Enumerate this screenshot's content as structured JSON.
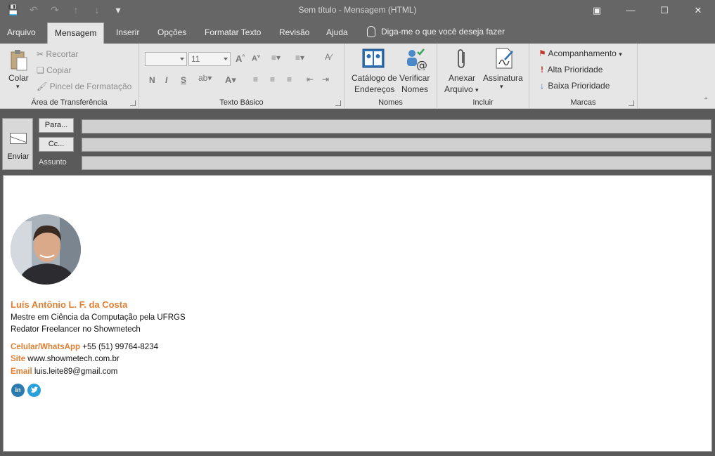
{
  "window": {
    "title": "Sem título  -  Mensagem (HTML)"
  },
  "tabs": [
    {
      "label": "Arquivo"
    },
    {
      "label": "Mensagem"
    },
    {
      "label": "Inserir"
    },
    {
      "label": "Opções"
    },
    {
      "label": "Formatar Texto"
    },
    {
      "label": "Revisão"
    },
    {
      "label": "Ajuda"
    }
  ],
  "tell_me": "Diga-me o que você deseja fazer",
  "ribbon": {
    "clipboard": {
      "label": "Área de Transferência",
      "paste": "Colar",
      "cut": "Recortar",
      "copy": "Copiar",
      "format_painter": "Pincel de Formatação"
    },
    "basic_text": {
      "label": "Texto Básico",
      "font_size": "11",
      "bold": "N",
      "italic": "I",
      "underline": "S",
      "font_color": "A"
    },
    "names": {
      "label": "Nomes",
      "address_book_1": "Catálogo de",
      "address_book_2": "Endereços",
      "check_names_1": "Verificar",
      "check_names_2": "Nomes"
    },
    "include": {
      "label": "Incluir",
      "attach_1": "Anexar",
      "attach_2": "Arquivo",
      "signature": "Assinatura"
    },
    "tags": {
      "label": "Marcas",
      "follow_up": "Acompanhamento",
      "high_priority": "Alta Prioridade",
      "low_priority": "Baixa Prioridade"
    }
  },
  "compose": {
    "send": "Enviar",
    "to_button": "Para...",
    "cc_button": "Cc...",
    "subject_label": "Assunto",
    "to_value": "",
    "cc_value": "",
    "subject_value": ""
  },
  "signature": {
    "name": "Luís Antônio L. F. da Costa",
    "line1": "Mestre em Ciência da Computação pela UFRGS",
    "line2": "Redator Freelancer no Showmetech",
    "phone_label": "Celular/WhatsApp",
    "phone_value": "+55 (51) 99764-8234",
    "site_label": "Site",
    "site_value": "www.showmetech.com.br",
    "email_label": "Email",
    "email_value": "luis.leite89@gmail.com",
    "linkedin_text": "in",
    "colors": {
      "accent": "#e07f33",
      "linkedin": "#2a7ab0",
      "twitter": "#27a0dc"
    }
  }
}
